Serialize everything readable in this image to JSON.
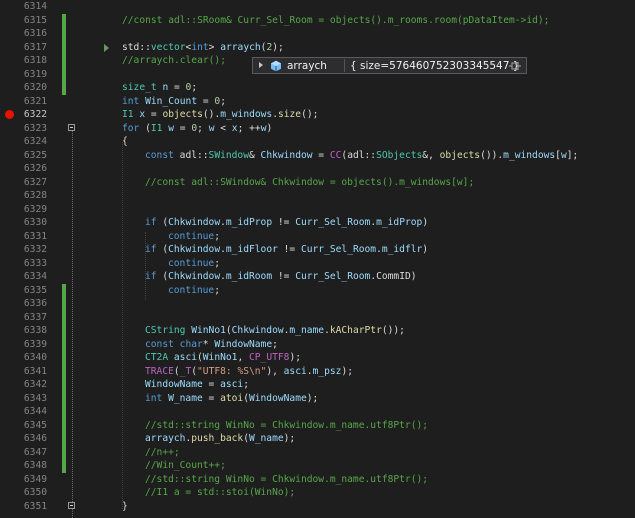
{
  "editor": {
    "first_line": 6314,
    "breakpoint_line": 6322,
    "current_line": 6322,
    "lines": [
      {
        "n": "6314",
        "ind": 0,
        "t": []
      },
      {
        "n": "6315",
        "ind": 0,
        "t": [
          [
            "cm",
            "//const adl::SRoom& Curr_Sel_Room = objects().m_rooms.room(pDataItem->id);"
          ]
        ]
      },
      {
        "n": "6316",
        "ind": 0,
        "t": []
      },
      {
        "n": "6317",
        "ind": 0,
        "t": [
          [
            "pl",
            "std::"
          ],
          [
            "ty",
            "vector"
          ],
          [
            "pl",
            "<"
          ],
          [
            "kw",
            "int"
          ],
          [
            "pl",
            "> "
          ],
          [
            "va",
            "arraych"
          ],
          [
            "pl",
            "("
          ],
          [
            "nu",
            "2"
          ],
          [
            "pl",
            ");"
          ]
        ]
      },
      {
        "n": "6318",
        "ind": 0,
        "t": [
          [
            "cm",
            "//arraych.clear();"
          ]
        ]
      },
      {
        "n": "6319",
        "ind": 0,
        "t": []
      },
      {
        "n": "6320",
        "ind": 0,
        "t": [
          [
            "ty",
            "size_t"
          ],
          [
            "pl",
            " "
          ],
          [
            "va",
            "n"
          ],
          [
            "pl",
            " = "
          ],
          [
            "nu",
            "0"
          ],
          [
            "pl",
            ";"
          ]
        ]
      },
      {
        "n": "6321",
        "ind": 0,
        "t": [
          [
            "kw",
            "int"
          ],
          [
            "pl",
            " "
          ],
          [
            "va",
            "Win_Count"
          ],
          [
            "pl",
            " = "
          ],
          [
            "nu",
            "0"
          ],
          [
            "pl",
            ";"
          ]
        ]
      },
      {
        "n": "6322",
        "ind": 0,
        "t": [
          [
            "ty",
            "I1"
          ],
          [
            "pl",
            " "
          ],
          [
            "va",
            "x"
          ],
          [
            "pl",
            " = "
          ],
          [
            "fn",
            "objects"
          ],
          [
            "pl",
            "()."
          ],
          [
            "va",
            "m_windows"
          ],
          [
            "pl",
            "."
          ],
          [
            "fn",
            "size"
          ],
          [
            "pl",
            "();"
          ]
        ]
      },
      {
        "n": "6323",
        "ind": 0,
        "t": [
          [
            "kw",
            "for"
          ],
          [
            "pl",
            " ("
          ],
          [
            "ty",
            "I1"
          ],
          [
            "pl",
            " "
          ],
          [
            "va",
            "w"
          ],
          [
            "pl",
            " = "
          ],
          [
            "nu",
            "0"
          ],
          [
            "pl",
            "; "
          ],
          [
            "va",
            "w"
          ],
          [
            "pl",
            " < "
          ],
          [
            "va",
            "x"
          ],
          [
            "pl",
            "; ++"
          ],
          [
            "va",
            "w"
          ],
          [
            "pl",
            ")"
          ]
        ]
      },
      {
        "n": "6324",
        "ind": 0,
        "t": [
          [
            "pl",
            "{"
          ]
        ]
      },
      {
        "n": "6325",
        "ind": 1,
        "t": [
          [
            "kw",
            "const"
          ],
          [
            "pl",
            " adl::"
          ],
          [
            "ty",
            "SWindow"
          ],
          [
            "pl",
            "& "
          ],
          [
            "va",
            "Chkwindow"
          ],
          [
            "pl",
            " = "
          ],
          [
            "ma",
            "CC"
          ],
          [
            "pl",
            "(adl::"
          ],
          [
            "ty",
            "SObjects"
          ],
          [
            "pl",
            "&, "
          ],
          [
            "fn",
            "objects"
          ],
          [
            "pl",
            "())."
          ],
          [
            "va",
            "m_windows"
          ],
          [
            "pl",
            "["
          ],
          [
            "va",
            "w"
          ],
          [
            "pl",
            "];"
          ]
        ]
      },
      {
        "n": "6326",
        "ind": 1,
        "t": []
      },
      {
        "n": "6327",
        "ind": 1,
        "t": [
          [
            "cm",
            "//const adl::SWindow& Chkwindow = objects().m_windows[w];"
          ]
        ]
      },
      {
        "n": "6328",
        "ind": 1,
        "t": []
      },
      {
        "n": "6329",
        "ind": 1,
        "t": []
      },
      {
        "n": "6330",
        "ind": 1,
        "t": [
          [
            "kw",
            "if"
          ],
          [
            "pl",
            " ("
          ],
          [
            "va",
            "Chkwindow"
          ],
          [
            "pl",
            "."
          ],
          [
            "va",
            "m_idProp"
          ],
          [
            "pl",
            " != "
          ],
          [
            "va",
            "Curr_Sel_Room"
          ],
          [
            "pl",
            "."
          ],
          [
            "va",
            "m_idProp"
          ],
          [
            "pl",
            ")"
          ]
        ]
      },
      {
        "n": "6331",
        "ind": 2,
        "t": [
          [
            "kw",
            "continue"
          ],
          [
            "pl",
            ";"
          ]
        ]
      },
      {
        "n": "6332",
        "ind": 1,
        "t": [
          [
            "kw",
            "if"
          ],
          [
            "pl",
            " ("
          ],
          [
            "va",
            "Chkwindow"
          ],
          [
            "pl",
            "."
          ],
          [
            "va",
            "m_idFloor"
          ],
          [
            "pl",
            " != "
          ],
          [
            "va",
            "Curr_Sel_Room"
          ],
          [
            "pl",
            "."
          ],
          [
            "va",
            "m_idflr"
          ],
          [
            "pl",
            ")"
          ]
        ]
      },
      {
        "n": "6333",
        "ind": 2,
        "t": [
          [
            "kw",
            "continue"
          ],
          [
            "pl",
            ";"
          ]
        ]
      },
      {
        "n": "6334",
        "ind": 1,
        "t": [
          [
            "kw",
            "if"
          ],
          [
            "pl",
            " ("
          ],
          [
            "va",
            "Chkwindow"
          ],
          [
            "pl",
            "."
          ],
          [
            "va",
            "m_idRoom"
          ],
          [
            "pl",
            " != "
          ],
          [
            "va",
            "Curr_Sel_Room"
          ],
          [
            "pl",
            ".CommID)"
          ]
        ]
      },
      {
        "n": "6335",
        "ind": 2,
        "t": [
          [
            "kw",
            "continue"
          ],
          [
            "pl",
            ";"
          ]
        ]
      },
      {
        "n": "6336",
        "ind": 1,
        "t": []
      },
      {
        "n": "6337",
        "ind": 1,
        "t": []
      },
      {
        "n": "6338",
        "ind": 1,
        "t": [
          [
            "ty",
            "CString"
          ],
          [
            "pl",
            " "
          ],
          [
            "va",
            "WinNo1"
          ],
          [
            "pl",
            "("
          ],
          [
            "va",
            "Chkwindow"
          ],
          [
            "pl",
            "."
          ],
          [
            "va",
            "m_name"
          ],
          [
            "pl",
            "."
          ],
          [
            "fn",
            "kACharPtr"
          ],
          [
            "pl",
            "());"
          ]
        ]
      },
      {
        "n": "6339",
        "ind": 1,
        "t": [
          [
            "kw",
            "const"
          ],
          [
            "pl",
            " "
          ],
          [
            "kw",
            "char"
          ],
          [
            "pl",
            "* "
          ],
          [
            "va",
            "WindowName"
          ],
          [
            "pl",
            ";"
          ]
        ]
      },
      {
        "n": "6340",
        "ind": 1,
        "t": [
          [
            "ty",
            "CT2A"
          ],
          [
            "pl",
            " "
          ],
          [
            "va",
            "asci"
          ],
          [
            "pl",
            "("
          ],
          [
            "va",
            "WinNo1"
          ],
          [
            "pl",
            ", "
          ],
          [
            "ma",
            "CP_UTF8"
          ],
          [
            "pl",
            ");"
          ]
        ]
      },
      {
        "n": "6341",
        "ind": 1,
        "t": [
          [
            "ma",
            "TRACE"
          ],
          [
            "pl",
            "("
          ],
          [
            "ma",
            "_T"
          ],
          [
            "pl",
            "("
          ],
          [
            "st",
            "\"UTF8: %S\\n\""
          ],
          [
            "pl",
            "), "
          ],
          [
            "va",
            "asci"
          ],
          [
            "pl",
            "."
          ],
          [
            "va",
            "m_psz"
          ],
          [
            "pl",
            ");"
          ]
        ]
      },
      {
        "n": "6342",
        "ind": 1,
        "t": [
          [
            "va",
            "WindowName"
          ],
          [
            "pl",
            " = "
          ],
          [
            "va",
            "asci"
          ],
          [
            "pl",
            ";"
          ]
        ]
      },
      {
        "n": "6343",
        "ind": 1,
        "t": [
          [
            "kw",
            "int"
          ],
          [
            "pl",
            " "
          ],
          [
            "va",
            "W_name"
          ],
          [
            "pl",
            " = "
          ],
          [
            "fn",
            "atoi"
          ],
          [
            "pl",
            "("
          ],
          [
            "va",
            "WindowName"
          ],
          [
            "pl",
            ");"
          ]
        ]
      },
      {
        "n": "6344",
        "ind": 1,
        "t": []
      },
      {
        "n": "6345",
        "ind": 1,
        "t": [
          [
            "cm",
            "//std::string WinNo = Chkwindow.m_name.utf8Ptr();"
          ]
        ]
      },
      {
        "n": "6346",
        "ind": 1,
        "t": [
          [
            "va",
            "arraych"
          ],
          [
            "pl",
            "."
          ],
          [
            "fn",
            "push_back"
          ],
          [
            "pl",
            "("
          ],
          [
            "va",
            "W_name"
          ],
          [
            "pl",
            ");"
          ]
        ]
      },
      {
        "n": "6347",
        "ind": 1,
        "t": [
          [
            "cm",
            "//n++;"
          ]
        ]
      },
      {
        "n": "6348",
        "ind": 1,
        "t": [
          [
            "cm",
            "//Win_Count++;"
          ]
        ]
      },
      {
        "n": "6349",
        "ind": 1,
        "t": [
          [
            "cm",
            "//std::string WinNo = Chkwindow.m_name.utf8Ptr();"
          ]
        ]
      },
      {
        "n": "6350",
        "ind": 1,
        "t": [
          [
            "cm",
            "//I1 a = std::stoi(WinNo);"
          ]
        ]
      },
      {
        "n": "6351",
        "ind": 0,
        "t": [
          [
            "pl",
            "}"
          ]
        ]
      }
    ]
  },
  "datatip": {
    "variable": "arraych",
    "value": "{ size=576460752303345547 }",
    "icon": "cube-icon",
    "pin_icon": "pin-icon",
    "icon_color": "#75beff"
  },
  "colors": {
    "background": "#1e1e1e",
    "keyword": "#569cd6",
    "type": "#4ec9b0",
    "function": "#dcdcaa",
    "variable": "#9cdcfe",
    "comment": "#57a64a",
    "string": "#d69d85",
    "number": "#b5cea8",
    "macro": "#bd63c5",
    "change_bar": "#57a64a",
    "breakpoint": "#e51400"
  }
}
